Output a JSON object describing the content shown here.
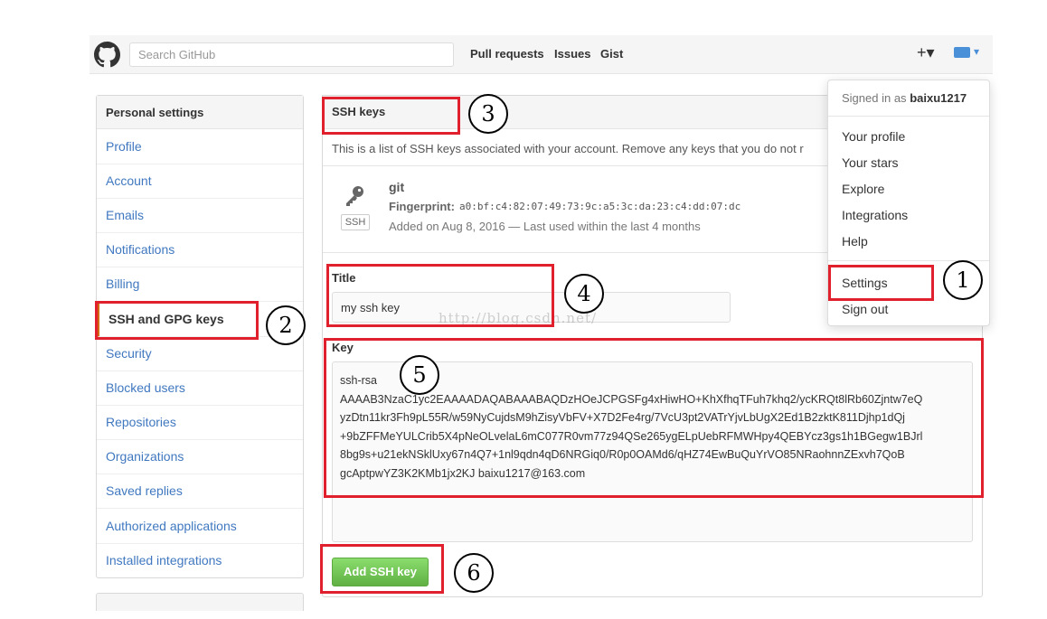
{
  "header": {
    "search_placeholder": "Search GitHub",
    "nav": [
      "Pull requests",
      "Issues",
      "Gist"
    ],
    "plus_label": "+▾",
    "avatar_caret": "▾"
  },
  "sidebar": {
    "heading": "Personal settings",
    "items": [
      "Profile",
      "Account",
      "Emails",
      "Notifications",
      "Billing",
      "SSH and GPG keys",
      "Security",
      "Blocked users",
      "Repositories",
      "Organizations",
      "Saved replies",
      "Authorized applications",
      "Installed integrations"
    ],
    "selected": "SSH and GPG keys"
  },
  "main": {
    "section_title": "SSH keys",
    "description": "This is a list of SSH keys associated with your account. Remove any keys that you do not r",
    "key": {
      "name": "git",
      "fingerprint_label": "Fingerprint:",
      "fingerprint": "a0:bf:c4:82:07:49:73:9c:a5:3c:da:23:c4:dd:07:dc",
      "added": "Added on Aug 8, 2016 — Last used within the last 4 months",
      "badge": "SSH"
    },
    "form": {
      "title_label": "Title",
      "title_value": "my ssh key",
      "key_label": "Key",
      "key_lines": [
        "ssh-rsa",
        "AAAAB3NzaC1yc2EAAAADAQABAAABAQDzHOeJCPGSFg4xHiwHO+KhXfhqTFuh7khq2/ycKRQt8lRb60Zjntw7eQ",
        "yzDtn11kr3Fh9pL55R/w59NyCujdsM9hZisyVbFV+X7D2Fe4rg/7VcU3pt2VATrYjvLbUgX2Ed1B2zktK811Djhp1dQj",
        "+9bZFFMeYULCrib5X4pNeOLvelaL6mC077R0vm77z94QSe265ygELpUebRFMWHpy4QEBYcz3gs1h1BGegw1BJrl",
        "8bg9s+u21ekNSklUxy67n4Q7+1nl9qdn4qD6NRGiq0/R0p0OAMd6/qHZ74EwBuQuYrVO85NRaohnnZExvh7QoB",
        "gcAptpwYZ3K2KMb1jx2KJ baixu1217@163.com"
      ],
      "submit_label": "Add SSH key"
    }
  },
  "dropdown": {
    "signed_in_prefix": "Signed in as",
    "username": "baixu1217",
    "items": [
      "Your profile",
      "Your stars",
      "Explore",
      "Integrations",
      "Help"
    ],
    "settings": "Settings",
    "sign_out": "Sign out"
  },
  "annotations": [
    "1",
    "2",
    "3",
    "4",
    "5",
    "6"
  ],
  "watermark": "http://blog.csdn.net/",
  "colors": {
    "annotation_red": "#e0212d",
    "link_blue": "#4078c0",
    "button_green": "#60b044"
  }
}
